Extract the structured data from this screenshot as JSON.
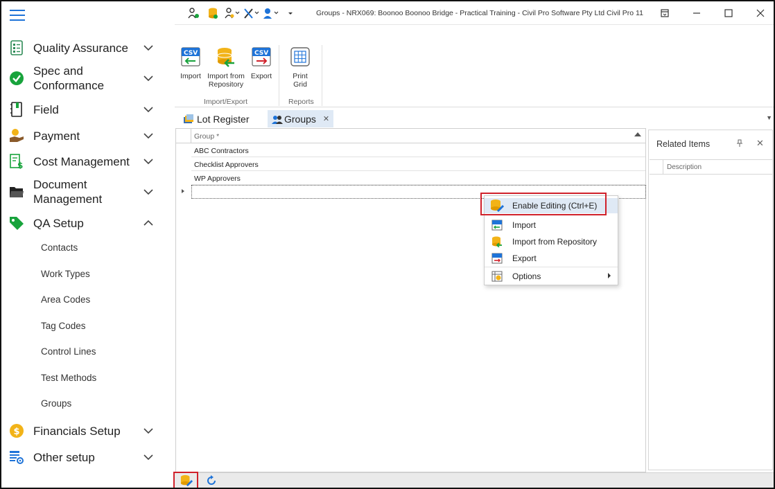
{
  "window": {
    "title": "Groups - NRX069: Boonoo Boonoo Bridge - Practical Training - Civil Pro Software Pty Ltd Civil Pro 11"
  },
  "sidebar": {
    "items": [
      {
        "label": "Quality Assurance"
      },
      {
        "label": "Spec and",
        "label2": "Conformance"
      },
      {
        "label": "Field"
      },
      {
        "label": "Payment"
      },
      {
        "label": "Cost Management"
      },
      {
        "label": "Document",
        "label2": "Management"
      },
      {
        "label": "QA Setup"
      },
      {
        "label": "Financials Setup"
      },
      {
        "label": "Other setup"
      }
    ],
    "sub_items": [
      "Contacts",
      "Work Types",
      "Area Codes",
      "Tag Codes",
      "Control Lines",
      "Test Methods",
      "Groups"
    ]
  },
  "ribbon": {
    "import_label": "Import",
    "import_repo_label1": "Import from",
    "import_repo_label2": "Repository",
    "export_label": "Export",
    "print_label1": "Print",
    "print_label2": "Grid",
    "group_import_export": "Import/Export",
    "group_reports": "Reports",
    "csv_text": "CSV"
  },
  "tabs": [
    {
      "label": "Lot Register"
    },
    {
      "label": "Groups"
    }
  ],
  "grid": {
    "column": "Group *",
    "rows": [
      "ABC Contractors",
      "Checklist Approvers",
      "WP Approvers"
    ]
  },
  "related": {
    "title": "Related Items",
    "column": "Description"
  },
  "context_menu": {
    "items": [
      "Enable Editing (Ctrl+E)",
      "Import",
      "Import from Repository",
      "Export",
      "Options"
    ]
  },
  "colors": {
    "accent": "#1e73d8",
    "highlight": "#d0202a",
    "green": "#18a33c",
    "gold": "#f2b318"
  }
}
